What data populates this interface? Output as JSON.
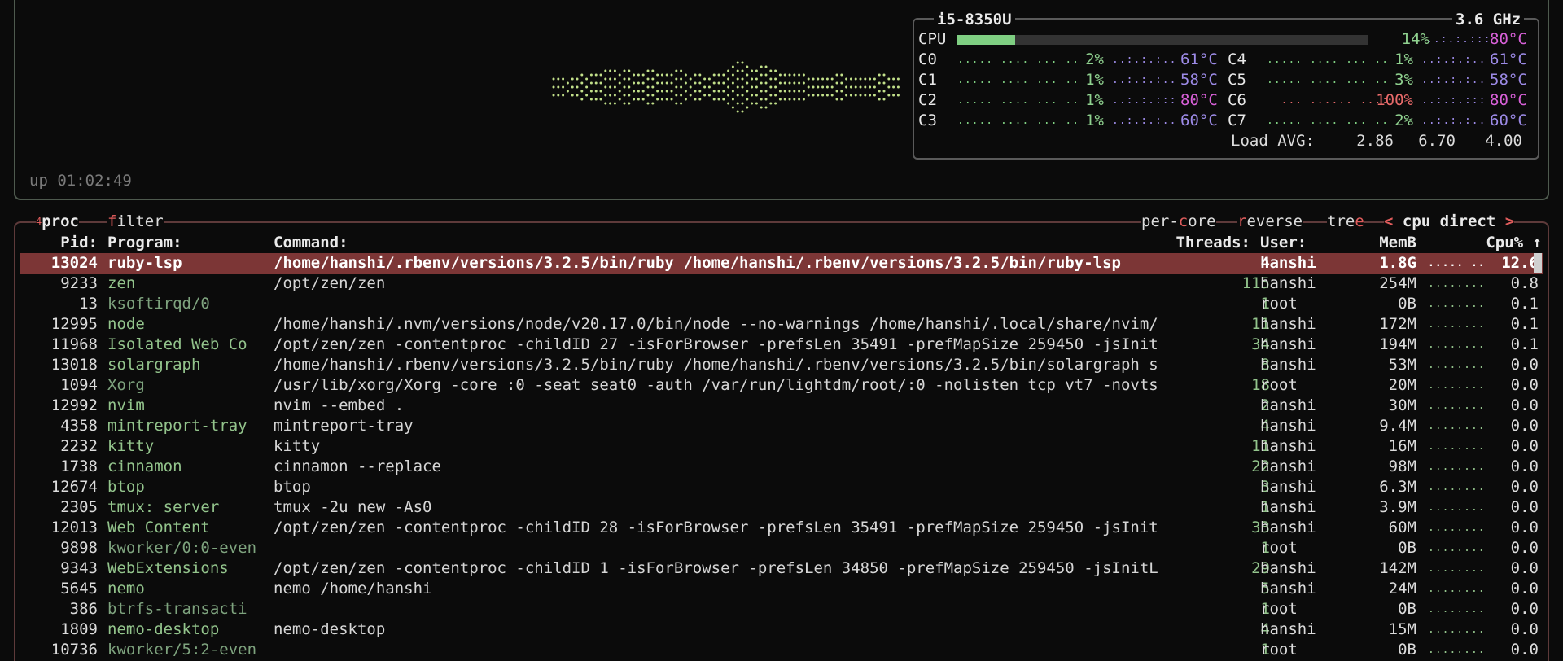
{
  "cpu": {
    "model": "i5-8350U",
    "freq": "3.6 GHz",
    "total": {
      "label": "CPU",
      "percent": "14%",
      "temp": "80°C",
      "fill": 0.14
    },
    "cores": [
      {
        "label": "C0",
        "percent": "2%",
        "temp": "61°C"
      },
      {
        "label": "C1",
        "percent": "1%",
        "temp": "58°C"
      },
      {
        "label": "C2",
        "percent": "1%",
        "temp": "80°C"
      },
      {
        "label": "C3",
        "percent": "1%",
        "temp": "60°C"
      },
      {
        "label": "C4",
        "percent": "1%",
        "temp": "61°C"
      },
      {
        "label": "C5",
        "percent": "3%",
        "temp": "58°C"
      },
      {
        "label": "C6",
        "percent": "100%",
        "temp": "80°C"
      },
      {
        "label": "C7",
        "percent": "2%",
        "temp": "60°C"
      }
    ],
    "load_label": "Load AVG:",
    "load": [
      "2.86",
      "6.70",
      "4.00"
    ],
    "uptime": "up 01:02:49"
  },
  "proc": {
    "tab_num": "4",
    "tab_proc": "proc",
    "tab_filter_key": "f",
    "tab_filter_rest": "ilter",
    "opt_percore_a": "per-",
    "opt_percore_key": "c",
    "opt_percore_b": "ore",
    "opt_reverse_key": "r",
    "opt_reverse_rest": "everse",
    "opt_tree_a": "tre",
    "opt_tree_key": "e",
    "sort_left": "<",
    "sort_label": "cpu direct",
    "sort_right": ">",
    "headers": {
      "pid": "Pid:",
      "program": "Program:",
      "command": "Command:",
      "threads": "Threads:",
      "user": "User:",
      "mem": "MemB",
      "cpu": "Cpu% ↑"
    },
    "rows": [
      {
        "pid": "13024",
        "program": "ruby-lsp",
        "command": "/home/hanshi/.rbenv/versions/3.2.5/bin/ruby /home/hanshi/.rbenv/versions/3.2.5/bin/ruby-lsp",
        "threads": "4",
        "user": "hanshi",
        "mem": "1.8G",
        "cpu": "12.6"
      },
      {
        "pid": "9233",
        "program": "zen",
        "command": "/opt/zen/zen",
        "threads": "115",
        "user": "hanshi",
        "mem": "254M",
        "cpu": "0.8"
      },
      {
        "pid": "13",
        "program": "ksoftirqd/0",
        "command": "",
        "threads": "1",
        "user": "root",
        "mem": "0B",
        "cpu": "0.1"
      },
      {
        "pid": "12995",
        "program": "node",
        "command": "/home/hanshi/.nvm/versions/node/v20.17.0/bin/node --no-warnings /home/hanshi/.local/share/nvim/",
        "threads": "11",
        "user": "hanshi",
        "mem": "172M",
        "cpu": "0.1"
      },
      {
        "pid": "11968",
        "program": "Isolated Web Co",
        "command": "/opt/zen/zen -contentproc -childID 27 -isForBrowser -prefsLen 35491 -prefMapSize 259450 -jsInit",
        "threads": "34",
        "user": "hanshi",
        "mem": "194M",
        "cpu": "0.1"
      },
      {
        "pid": "13018",
        "program": "solargraph",
        "command": "/home/hanshi/.rbenv/versions/3.2.5/bin/ruby /home/hanshi/.rbenv/versions/3.2.5/bin/solargraph s",
        "threads": "8",
        "user": "hanshi",
        "mem": "53M",
        "cpu": "0.0"
      },
      {
        "pid": "1094",
        "program": "Xorg",
        "command": "/usr/lib/xorg/Xorg -core :0 -seat seat0 -auth /var/run/lightdm/root/:0 -nolisten tcp vt7 -novts",
        "threads": "18",
        "user": "root",
        "mem": "20M",
        "cpu": "0.0"
      },
      {
        "pid": "12992",
        "program": "nvim",
        "command": "nvim --embed .",
        "threads": "2",
        "user": "hanshi",
        "mem": "30M",
        "cpu": "0.0"
      },
      {
        "pid": "4358",
        "program": "mintreport-tray",
        "command": "mintreport-tray",
        "threads": "4",
        "user": "hanshi",
        "mem": "9.4M",
        "cpu": "0.0"
      },
      {
        "pid": "2232",
        "program": "kitty",
        "command": "kitty",
        "threads": "11",
        "user": "hanshi",
        "mem": "16M",
        "cpu": "0.0"
      },
      {
        "pid": "1738",
        "program": "cinnamon",
        "command": "cinnamon --replace",
        "threads": "22",
        "user": "hanshi",
        "mem": "98M",
        "cpu": "0.0"
      },
      {
        "pid": "12674",
        "program": "btop",
        "command": "btop",
        "threads": "3",
        "user": "hanshi",
        "mem": "6.3M",
        "cpu": "0.0"
      },
      {
        "pid": "2305",
        "program": "tmux: server",
        "command": "tmux -2u new -As0",
        "threads": "1",
        "user": "hanshi",
        "mem": "3.9M",
        "cpu": "0.0"
      },
      {
        "pid": "12013",
        "program": "Web Content",
        "command": "/opt/zen/zen -contentproc -childID 28 -isForBrowser -prefsLen 35491 -prefMapSize 259450 -jsInit",
        "threads": "33",
        "user": "hanshi",
        "mem": "60M",
        "cpu": "0.0"
      },
      {
        "pid": "9898",
        "program": "kworker/0:0-even",
        "command": "",
        "threads": "1",
        "user": "root",
        "mem": "0B",
        "cpu": "0.0"
      },
      {
        "pid": "9343",
        "program": "WebExtensions",
        "command": "/opt/zen/zen -contentproc -childID 1 -isForBrowser -prefsLen 34850 -prefMapSize 259450 -jsInitL",
        "threads": "29",
        "user": "hanshi",
        "mem": "142M",
        "cpu": "0.0"
      },
      {
        "pid": "5645",
        "program": "nemo",
        "command": "nemo /home/hanshi",
        "threads": "5",
        "user": "hanshi",
        "mem": "24M",
        "cpu": "0.0"
      },
      {
        "pid": "386",
        "program": "btrfs-transacti",
        "command": "",
        "threads": "1",
        "user": "root",
        "mem": "0B",
        "cpu": "0.0"
      },
      {
        "pid": "1809",
        "program": "nemo-desktop",
        "command": "nemo-desktop",
        "threads": "4",
        "user": "hanshi",
        "mem": "15M",
        "cpu": "0.0"
      },
      {
        "pid": "10736",
        "program": "kworker/5:2-even",
        "command": "",
        "threads": "1",
        "user": "root",
        "mem": "0B",
        "cpu": "0.0"
      }
    ]
  }
}
